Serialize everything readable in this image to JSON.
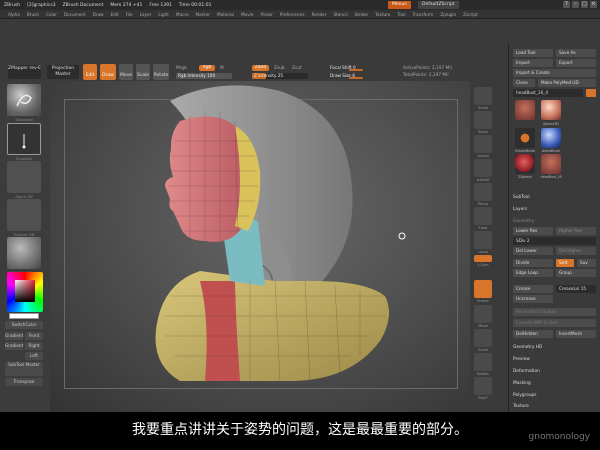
{
  "titlebar": {
    "app": "ZBrush",
    "items": [
      "ZBrush",
      "[2]graphics3",
      "ZBrush Document",
      "Mem 274 +41",
      "Free 1391",
      "Time 00:01:01"
    ],
    "menus_button": "Menus",
    "script_button": "DefaultZScript"
  },
  "menubar": [
    "Alpha",
    "Brush",
    "Color",
    "Document",
    "Draw",
    "Edit",
    "File",
    "Layer",
    "Light",
    "Macro",
    "Marker",
    "Material",
    "Movie",
    "Picker",
    "Preferences",
    "Render",
    "Stencil",
    "Stroke",
    "Texture",
    "Tool",
    "Transform",
    "Zplugin",
    "Zscript"
  ],
  "shelf": {
    "zmapper": "ZMapper rev-E",
    "projection": "Projection Master",
    "edit": "Edit",
    "draw": "Draw",
    "move": "Move",
    "scale": "Scale",
    "rotate": "Rotate",
    "mrgb": "Mrgb",
    "rgb": "Rgb",
    "m": "M",
    "rgb_intensity": "Rgb Intensity 100",
    "zadd": "Zadd",
    "zsub": "Zsub",
    "zcut": "Zcut",
    "z_intensity": "Z Intensity 25",
    "focal_shift": "Focal Shift 0",
    "draw_size": "Draw Size 8",
    "active_points": "ActivePoints: 2,197 Mil",
    "total_points": "TotalPoints: 2,197 Mil"
  },
  "lefttray": {
    "thumb_labels": [
      "Standard",
      "DragDot",
      "Alpha Off",
      "Texture Off",
      "MatCap Gray"
    ],
    "switchcolor": "SwitchColor",
    "gradient": "Gradient",
    "front": "Front",
    "right": "Right",
    "left": "Left",
    "subtool_master": "SubTool Master",
    "transpose": "Transpose"
  },
  "rightshelf": [
    "Scroll",
    "Zoom",
    "Actual",
    "AAHalf",
    "Persp",
    "Floor",
    "Local",
    "L.Sym",
    "Xyz",
    "Frame",
    "Move",
    "Scale",
    "Rotate",
    "PolyF",
    "Transp",
    "Ghost",
    "Solo",
    "Xpose"
  ],
  "rpanel": {
    "load_tool": "Load Tool",
    "save_as": "Save As",
    "import": "Import",
    "export": "Export",
    "import_lbl": "Import & Create",
    "clone": "Clone",
    "make_polymesh": "Make PolyMesh3D",
    "current_tool": "headBust_16_4",
    "tools": [
      "headBust_16",
      "Sphere3D",
      "AlphaBrush",
      "SimpleBrush",
      "Cylinder3D",
      "SingleBrush",
      "HeadBust_16",
      "ZSphere"
    ],
    "subtool": "SubTool",
    "layers": "Layers",
    "geometry": "Geometry",
    "lower_res": "Lower Res",
    "higher_res": "Higher Res",
    "sdiv": "SDiv 2",
    "del_lower": "Del Lower",
    "del_higher": "Del Higher",
    "divide": "Divide",
    "smt": "Smt",
    "suv": "Suv",
    "edge_loop": "Edge Loop",
    "group": "Group",
    "crease": "Crease",
    "creaselvl": "CreaseLvl 15",
    "uncrease": "Uncrease",
    "reconstruct": "Reconstruct Subdiv",
    "convert_bpr": "Convert BPR To Geo",
    "del_hidden": "DelHidden",
    "insert_mesh": "InsertMesh",
    "sections": [
      "Geometry HD",
      "Preview",
      "Deformation",
      "Masking",
      "Polygroups",
      "Texture"
    ]
  },
  "subtitle": "我要重点讲讲关于姿势的问题，这是最最重要的部分。",
  "watermark": "gnomonology"
}
